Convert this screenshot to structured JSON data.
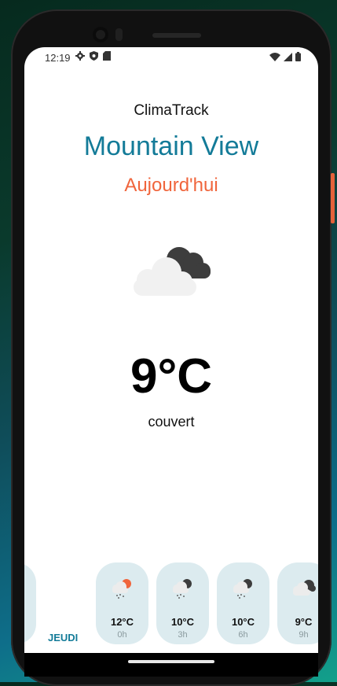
{
  "status_bar": {
    "time": "12:19",
    "left_icons": [
      "gear-icon",
      "shield-icon",
      "sim-card-icon"
    ],
    "right_icons": [
      "wifi-icon",
      "signal-icon",
      "battery-icon"
    ]
  },
  "app": {
    "name": "ClimaTrack",
    "city": "Mountain View",
    "day_label": "Aujourd'hui"
  },
  "current": {
    "icon": "cloudy-icon",
    "temperature": "9°C",
    "condition": "couvert"
  },
  "forecast": {
    "day_label": "JEUDI",
    "hours": [
      {
        "temp": "12°C",
        "hour": "0h",
        "icon": "rain-sun-icon"
      },
      {
        "temp": "10°C",
        "hour": "3h",
        "icon": "rain-cloud-icon"
      },
      {
        "temp": "10°C",
        "hour": "6h",
        "icon": "rain-cloud-icon"
      },
      {
        "temp": "9°C",
        "hour": "9h",
        "icon": "cloudy-icon"
      }
    ]
  },
  "colors": {
    "accent": "#137b98",
    "day": "#f0653c",
    "card": "#dcebef"
  }
}
